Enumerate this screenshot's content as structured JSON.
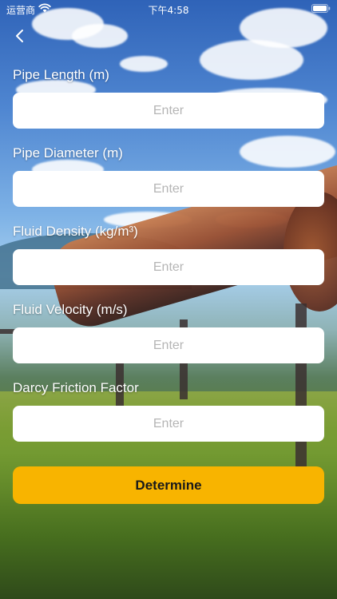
{
  "status_bar": {
    "carrier": "运营商",
    "time": "下午4:58",
    "wifi_icon": "wifi-icon",
    "battery_icon": "battery-icon"
  },
  "nav": {
    "back_icon": "chevron-left-icon"
  },
  "fields": [
    {
      "label": "Pipe Length (m)",
      "placeholder": "Enter",
      "value": ""
    },
    {
      "label": "Pipe Diameter (m)",
      "placeholder": "Enter",
      "value": ""
    },
    {
      "label": "Fluid Density (kg/m³)",
      "placeholder": "Enter",
      "value": ""
    },
    {
      "label": "Fluid Velocity (m/s)",
      "placeholder": "Enter",
      "value": ""
    },
    {
      "label": "Darcy Friction Factor",
      "placeholder": "Enter",
      "value": ""
    }
  ],
  "actions": {
    "determine_label": "Determine"
  },
  "colors": {
    "button": "#f8b400",
    "input_bg": "#ffffff",
    "label_text": "#ffffff"
  }
}
